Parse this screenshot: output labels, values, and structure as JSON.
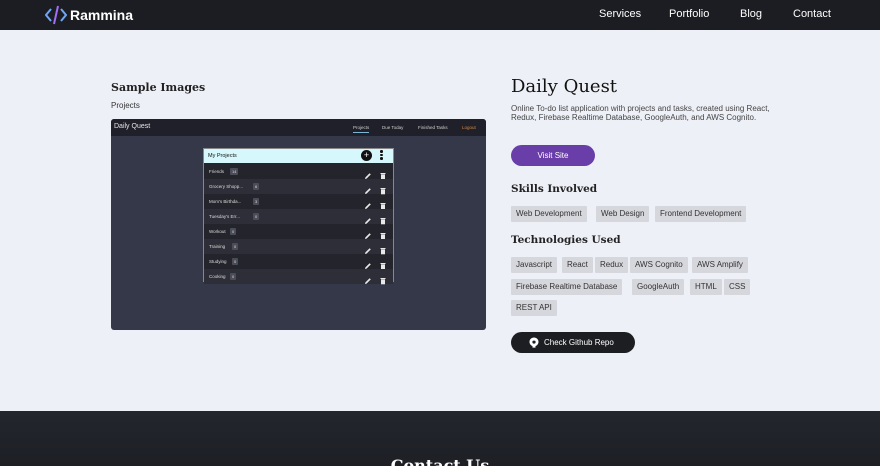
{
  "nav": {
    "brand": "Rammina",
    "links": [
      "Services",
      "Portfolio",
      "Blog",
      "Contact"
    ]
  },
  "sample": {
    "title": "Sample Images",
    "caption": "Projects",
    "screenshot": {
      "app_title": "Daily Quest",
      "nav": [
        "Projects",
        "Due Today",
        "Finished Tasks",
        "Logout"
      ],
      "card_title": "My Projects",
      "rows": [
        {
          "label": "Friends",
          "count": "14"
        },
        {
          "label": "Grocery Shopp...",
          "count": "6"
        },
        {
          "label": "Mom's Birthda...",
          "count": "3"
        },
        {
          "label": "Tuesday's Err...",
          "count": "0"
        },
        {
          "label": "Workout",
          "count": "0"
        },
        {
          "label": "Training",
          "count": "0"
        },
        {
          "label": "Studying",
          "count": "0"
        },
        {
          "label": "Cooking",
          "count": "0"
        }
      ]
    }
  },
  "project": {
    "title": "Daily Quest",
    "description": "Online To-do list application with projects and tasks, created using React, Redux, Firebase Realtime Database, GoogleAuth, and AWS Cognito.",
    "visit_label": "Visit Site",
    "skills_heading": "Skills Involved",
    "skills": [
      "Web Development",
      "Web Design",
      "Frontend Development"
    ],
    "tech_heading": "Technologies Used",
    "technologies": [
      "Javascript",
      "React",
      "Redux",
      "AWS Cognito",
      "AWS Amplify",
      "Firebase Realtime Database",
      "GoogleAuth",
      "HTML",
      "CSS",
      "REST API"
    ],
    "github_label": "Check Github Repo"
  },
  "footer": {
    "title": "Contact Us"
  },
  "colors": {
    "accent": "#6a3ea8",
    "nav_bg": "#1c1d22",
    "page_bg": "#eef0f8"
  }
}
